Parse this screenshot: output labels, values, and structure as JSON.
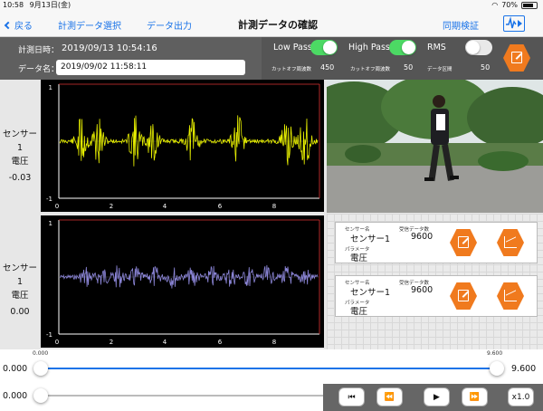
{
  "status": {
    "time": "10:58",
    "date": "9月13日(金)",
    "battery": "70%"
  },
  "nav": {
    "back": "戻る",
    "select": "計測データ選択",
    "export": "データ出力",
    "title": "計測データの確認",
    "sync": "同期検証"
  },
  "info": {
    "datetime_label": "計測日時：",
    "datetime": "2019/09/13 10:54:16",
    "name_label": "データ名：",
    "name": "2019/09/02 11:58:11",
    "low_pass": {
      "label": "Low Pass",
      "on": true,
      "cutoff_label": "カットオフ周波数",
      "value": "450"
    },
    "high_pass": {
      "label": "High Pass",
      "on": true,
      "cutoff_label": "カットオフ周波数",
      "value": "50"
    },
    "rms": {
      "label": "RMS",
      "on": false,
      "section_label": "データ区間",
      "value": "50"
    }
  },
  "sensors": [
    {
      "name": "センサー1",
      "param": "電圧",
      "value": "-0.03"
    },
    {
      "name": "センサー1",
      "param": "電圧",
      "value": "0.00"
    }
  ],
  "plots": [
    {
      "color": "#e8f000",
      "y_top_label": "1",
      "y_bottom_label": "-1",
      "x_ticks": [
        "0",
        "2",
        "4",
        "6",
        "8"
      ]
    },
    {
      "color": "#8c86d8",
      "y_top_label": "1",
      "y_bottom_label": "-1",
      "x_ticks": [
        "0",
        "2",
        "4",
        "6",
        "8"
      ]
    }
  ],
  "cards": [
    {
      "sensor_label": "センサー名",
      "sensor": "センサー1",
      "count_label": "受信データ数",
      "count": "9600",
      "param_label": "パラメータ",
      "param": "電圧"
    },
    {
      "sensor_label": "センサー名",
      "sensor": "センサー1",
      "count_label": "受信データ数",
      "count": "9600",
      "param_label": "パラメータ",
      "param": "電圧"
    }
  ],
  "range_slider": {
    "min_tick": "0.000",
    "max_tick": "9.600",
    "start": "0.000",
    "end": "9.600"
  },
  "position_slider": {
    "value": "0.000",
    "progress": 0
  },
  "playback": {
    "speed": "x1.0"
  },
  "colors": {
    "accent": "#1a73e8",
    "orange": "#f07a1e",
    "toggle_on": "#4cd964"
  }
}
